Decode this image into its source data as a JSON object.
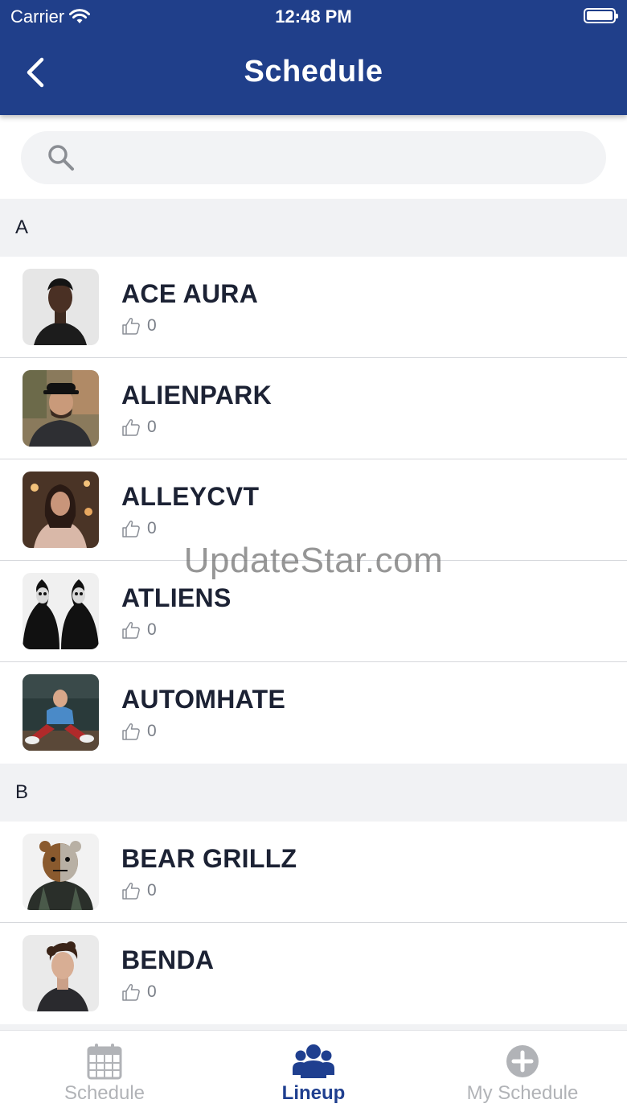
{
  "status_bar": {
    "carrier": "Carrier",
    "time": "12:48 PM"
  },
  "header": {
    "title": "Schedule"
  },
  "search": {
    "placeholder": ""
  },
  "sections": [
    {
      "letter": "A",
      "artists": [
        {
          "name": "ACE AURA",
          "likes": "0"
        },
        {
          "name": "ALIENPARK",
          "likes": "0"
        },
        {
          "name": "ALLEYCVT",
          "likes": "0"
        },
        {
          "name": "ATLIENS",
          "likes": "0"
        },
        {
          "name": "AUTOMHATE",
          "likes": "0"
        }
      ]
    },
    {
      "letter": "B",
      "artists": [
        {
          "name": "BEAR GRILLZ",
          "likes": "0"
        },
        {
          "name": "BENDA",
          "likes": "0"
        }
      ]
    }
  ],
  "watermark": "UpdateStar.com",
  "tabbar": {
    "tabs": [
      {
        "label": "Schedule",
        "icon": "calendar-icon",
        "active": false
      },
      {
        "label": "Lineup",
        "icon": "group-icon",
        "active": true
      },
      {
        "label": "My Schedule",
        "icon": "plus-circle-icon",
        "active": false
      }
    ]
  },
  "colors": {
    "header_bg": "#203f8a",
    "active_tab": "#1f3f8f",
    "inactive_tab": "#b1b3b7",
    "section_bg": "#f1f2f4"
  }
}
